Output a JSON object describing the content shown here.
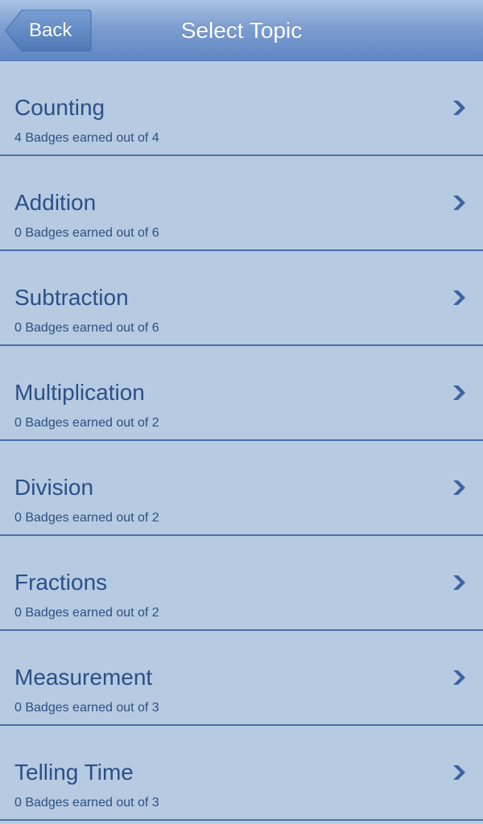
{
  "nav": {
    "back_label": "Back",
    "title": "Select Topic"
  },
  "topics": [
    {
      "name": "Counting",
      "badges": "4 Badges earned out of 4"
    },
    {
      "name": "Addition",
      "badges": "0 Badges earned out of 6"
    },
    {
      "name": "Subtraction",
      "badges": "0 Badges earned out of 6"
    },
    {
      "name": "Multiplication",
      "badges": "0 Badges earned out of 2"
    },
    {
      "name": "Division",
      "badges": "0 Badges earned out of 2"
    },
    {
      "name": "Fractions",
      "badges": "0 Badges earned out of 2"
    },
    {
      "name": "Measurement",
      "badges": "0 Badges earned out of 3"
    },
    {
      "name": "Telling Time",
      "badges": "0 Badges earned out of 3"
    }
  ],
  "icons": {
    "back": "back-arrow-shape",
    "row_disclosure": "chevron-right-icon"
  },
  "colors": {
    "nav_bar": "#6f94cb",
    "background": "#b6cbe2",
    "text": "#2c4f86",
    "separator": "#4a6ea6"
  }
}
